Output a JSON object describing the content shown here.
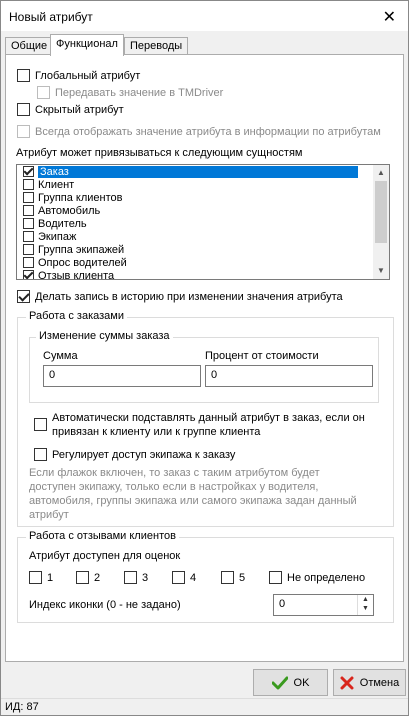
{
  "window": {
    "title": "Новый атрибут"
  },
  "tabs": [
    {
      "label": "Общие"
    },
    {
      "label": "Функционал"
    },
    {
      "label": "Переводы"
    }
  ],
  "options": {
    "global": "Глобальный атрибут",
    "pass_tmdriver": "Передавать значение в TMDriver",
    "hidden": "Скрытый атрибут",
    "always_show": "Всегда отображать значение атрибута в информации по атрибутам"
  },
  "entities": {
    "heading": "Атрибут может привязываться к следующим сущностям",
    "items": [
      {
        "label": "Заказ",
        "checked": true
      },
      {
        "label": "Клиент",
        "checked": false
      },
      {
        "label": "Группа клиентов",
        "checked": false
      },
      {
        "label": "Автомобиль",
        "checked": false
      },
      {
        "label": "Водитель",
        "checked": false
      },
      {
        "label": "Экипаж",
        "checked": false
      },
      {
        "label": "Группа экипажей",
        "checked": false
      },
      {
        "label": "Опрос водителей",
        "checked": false
      },
      {
        "label": "Отзыв клиента",
        "checked": true
      }
    ]
  },
  "history": {
    "label": "Делать запись в историю при изменении значения атрибута"
  },
  "orders": {
    "legend": "Работа с заказами",
    "sum_change": {
      "legend": "Изменение суммы заказа",
      "sum_label": "Сумма",
      "sum_value": "0",
      "percent_label": "Процент от стоимости",
      "percent_value": "0"
    },
    "auto_subst": "Автоматически подставлять данный атрибут в заказ, если он привязан к клиенту или к группе клиента",
    "crew_access": "Регулирует доступ экипажа к заказу",
    "hint": "Если флажок включен, то заказ с таким атрибутом будет доступен экипажу, только если в настройках у водителя, автомобиля, группы экипажа или самого экипажа задан данный атрибут"
  },
  "reviews": {
    "legend": "Работа с отзывами клиентов",
    "ratings_label": "Атрибут доступен для оценок",
    "ratings": [
      "1",
      "2",
      "3",
      "4",
      "5",
      "Не определено"
    ],
    "icon_index_label": "Индекс иконки (0 - не задано)",
    "icon_index_value": "0"
  },
  "buttons": {
    "ok": "OK",
    "cancel": "Отмена"
  },
  "status": {
    "id_text": "ИД: 87"
  }
}
